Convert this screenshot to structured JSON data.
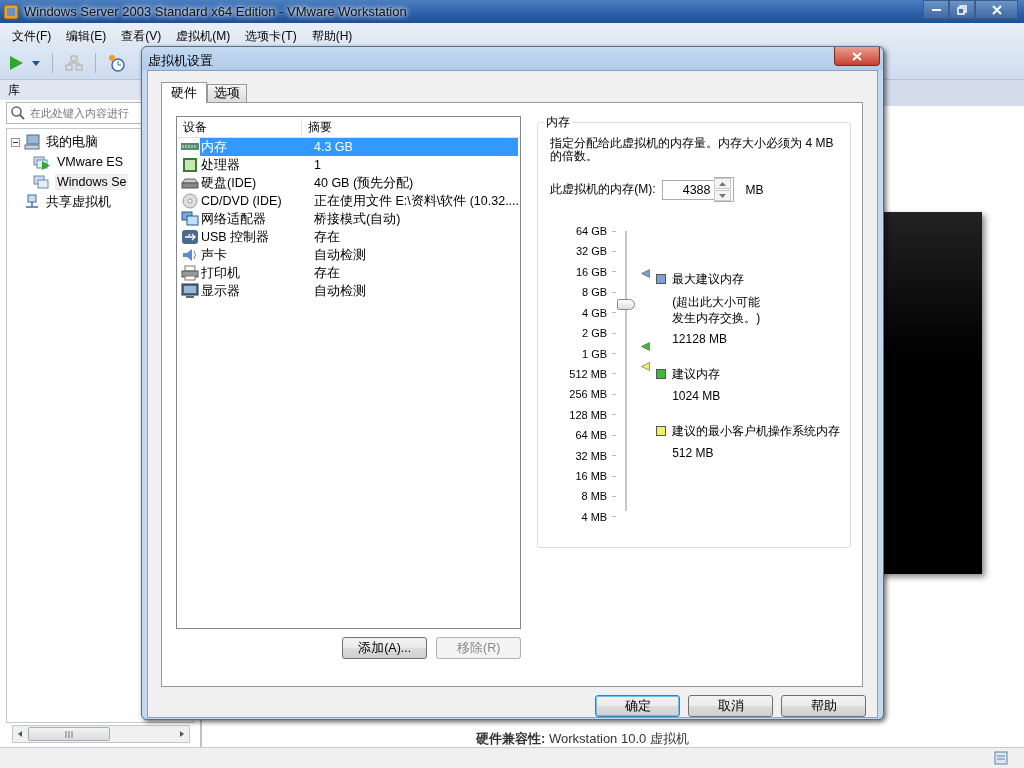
{
  "window": {
    "title": "Windows Server 2003 Standard x64 Edition - VMware Workstation"
  },
  "menu": [
    "文件(F)",
    "编辑(E)",
    "查看(V)",
    "虚拟机(M)",
    "选项卡(T)",
    "帮助(H)"
  ],
  "library": {
    "title": "库",
    "search": {
      "placeholder": "在此处键入内容进行"
    },
    "tree": [
      {
        "label": "我的电脑",
        "kind": "computer",
        "expanded": true,
        "selected": false,
        "children": [
          {
            "label": "VMware ES",
            "kind": "vm-running",
            "selected": false
          },
          {
            "label": "Windows Se",
            "kind": "vm",
            "selected": true
          }
        ]
      },
      {
        "label": "共享虚拟机",
        "kind": "shared",
        "selected": false
      }
    ]
  },
  "details": {
    "text": "**硬件兼容性:** Workstation 10.0 虚拟机"
  },
  "dialog": {
    "title": "虚拟机设置",
    "tabs": [
      {
        "label": "硬件",
        "selected": true
      },
      {
        "label": "选项",
        "selected": false
      }
    ],
    "devices": {
      "columns": [
        "设备",
        "摘要"
      ],
      "rows": [
        {
          "kind": "memory",
          "device": "内存",
          "summary": "4.3 GB",
          "selected": true
        },
        {
          "kind": "cpu",
          "device": "处理器",
          "summary": "1",
          "selected": false
        },
        {
          "kind": "disk",
          "device": "硬盘(IDE)",
          "summary": "40 GB (预先分配)",
          "selected": false
        },
        {
          "kind": "cd",
          "device": "CD/DVD (IDE)",
          "summary": "正在使用文件 E:\\资料\\软件 (10.32....",
          "selected": false
        },
        {
          "kind": "network",
          "device": "网络适配器",
          "summary": "桥接模式(自动)",
          "selected": false
        },
        {
          "kind": "usb",
          "device": "USB 控制器",
          "summary": "存在",
          "selected": false
        },
        {
          "kind": "sound",
          "device": "声卡",
          "summary": "自动检测",
          "selected": false
        },
        {
          "kind": "printer",
          "device": "打印机",
          "summary": "存在",
          "selected": false
        },
        {
          "kind": "display",
          "device": "显示器",
          "summary": "自动检测",
          "selected": false
        }
      ]
    },
    "device_buttons": [
      {
        "label": "添加(A)...",
        "disabled": false
      },
      {
        "label": "移除(R)",
        "disabled": true
      }
    ],
    "memory": {
      "title": "内存",
      "description": "指定分配给此虚拟机的内存量。内存大小必须为 4 MB 的倍数。",
      "field_label": "此虚拟机的内存(M):",
      "value": "4388",
      "unit": "MB",
      "slider": {
        "level": 0.72,
        "ticks": [
          "64 GB",
          "32 GB",
          "16 GB",
          "8 GB",
          "4 GB",
          "2 GB",
          "1 GB",
          "512 MB",
          "256 MB",
          "128 MB",
          "64 MB",
          "32 MB",
          "16 MB",
          "8 MB",
          "4 MB"
        ]
      },
      "legend": [
        {
          "color": "#7f9fd5",
          "label": "最大建议内存",
          "note": "(超出此大小可能发生内存交换。)",
          "value": "12128 MB",
          "level": 0.83
        },
        {
          "color": "#3cb83c",
          "label": "建议内存",
          "value": "1024 MB",
          "level": 0.57
        },
        {
          "color": "#f2f060",
          "label": "建议的最小客户机操作系统内存",
          "value": "512 MB",
          "level": 0.5
        }
      ]
    },
    "buttons": [
      {
        "label": "确定",
        "default": true
      },
      {
        "label": "取消",
        "default": false
      },
      {
        "label": "帮助",
        "default": false
      }
    ]
  }
}
